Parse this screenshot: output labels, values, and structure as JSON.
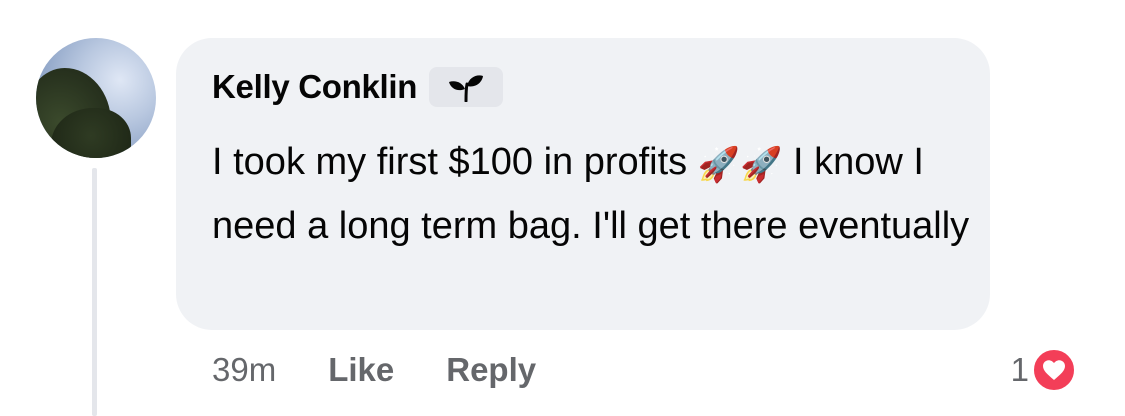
{
  "comment": {
    "author": "Kelly Conklin",
    "author_badge_icon": "sprout-icon",
    "text_part1": "I took my first $100 in profits ",
    "rocket_emoji": "🚀",
    "text_part2": " I know I need a long term bag. I'll get there eventually",
    "timestamp": "39m",
    "like_label": "Like",
    "reply_label": "Reply",
    "reaction_count": "1",
    "reaction_icon": "heart-icon"
  },
  "colors": {
    "bubble_bg": "#f0f2f5",
    "secondary_text": "#65676b",
    "heart": "#f33e58"
  }
}
